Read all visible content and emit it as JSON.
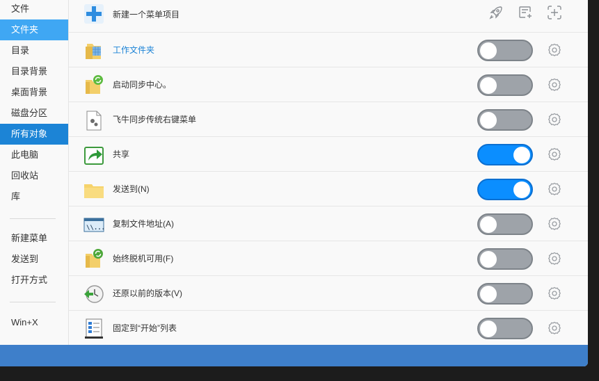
{
  "sidebar": {
    "items": [
      {
        "label": "文件"
      },
      {
        "label": "文件夹"
      },
      {
        "label": "目录"
      },
      {
        "label": "目录背景"
      },
      {
        "label": "桌面背景"
      },
      {
        "label": "磁盘分区"
      },
      {
        "label": "所有对象"
      },
      {
        "label": "此电脑"
      },
      {
        "label": "回收站"
      },
      {
        "label": "库"
      }
    ],
    "group2": [
      {
        "label": "新建菜单"
      },
      {
        "label": "发送到"
      },
      {
        "label": "打开方式"
      }
    ],
    "group3": [
      {
        "label": "Win+X"
      }
    ],
    "selected": "文件夹",
    "highlighted": "所有对象"
  },
  "toolbar": {
    "new_item_label": "新建一个菜单项目",
    "icons": [
      "rocket-icon",
      "edit-list-icon",
      "add-square-icon"
    ]
  },
  "menu_items": [
    {
      "label": "工作文件夹",
      "enabled": false,
      "icon": "work-folder-icon"
    },
    {
      "label": "启动同步中心。",
      "enabled": false,
      "icon": "sync-folder-icon"
    },
    {
      "label": "飞牛同步传统右键菜单",
      "enabled": false,
      "icon": "settings-file-icon"
    },
    {
      "label": "共享",
      "enabled": true,
      "icon": "share-icon"
    },
    {
      "label": "发送到(N)",
      "enabled": true,
      "icon": "folder-icon"
    },
    {
      "label": "复制文件地址(A)",
      "enabled": false,
      "icon": "path-icon"
    },
    {
      "label": "始终脱机可用(F)",
      "enabled": false,
      "icon": "offline-folder-icon"
    },
    {
      "label": "还原以前的版本(V)",
      "enabled": false,
      "icon": "restore-clock-icon"
    },
    {
      "label": "固定到“开始”列表",
      "enabled": false,
      "icon": "pin-start-icon"
    }
  ],
  "colors": {
    "sidebar_selected": "#3fa7f3",
    "sidebar_highlight": "#1c84d6",
    "toggle_on": "#0b8eff",
    "toggle_off": "#9ea3a9",
    "bottom_bar": "#3e7fca"
  }
}
